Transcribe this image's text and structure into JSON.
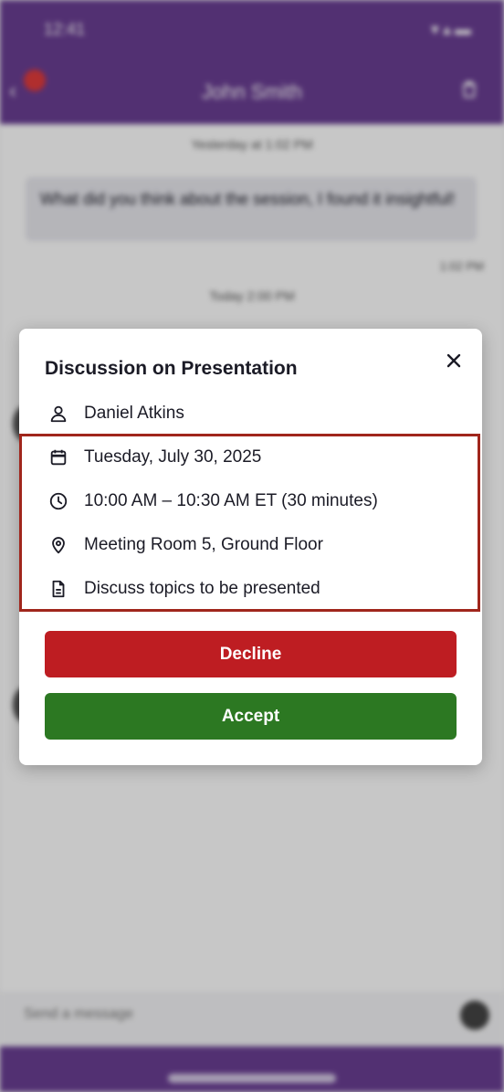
{
  "status_bar": {
    "time": "12:41",
    "icons_text": "▾▴▬"
  },
  "app_bar": {
    "title": "John Smith",
    "back_glyph": "‹"
  },
  "chat": {
    "timestamp_top": "Yesterday at 1:02 PM",
    "message_text": "What did you think about the session, I found it insightful!",
    "message_time": "1:02 PM",
    "timestamp_today": "Today 2:00 PM",
    "input_placeholder": "Send a message"
  },
  "dialog": {
    "title": "Discussion on Presentation",
    "organizer": "Daniel Atkins",
    "date": "Tuesday, July 30, 2025",
    "time": "10:00 AM – 10:30 AM ET (30 minutes)",
    "location": "Meeting Room 5, Ground Floor",
    "description": "Discuss topics to be presented",
    "decline_label": "Decline",
    "accept_label": "Accept"
  },
  "icons": {
    "person": "person-icon",
    "calendar": "calendar-icon",
    "clock": "clock-icon",
    "location": "location-pin-icon",
    "document": "document-icon",
    "close": "close-icon"
  },
  "colors": {
    "brand": "#6a3e93",
    "decline": "#be1d22",
    "accept": "#2c7822",
    "highlight": "#a0261c"
  }
}
